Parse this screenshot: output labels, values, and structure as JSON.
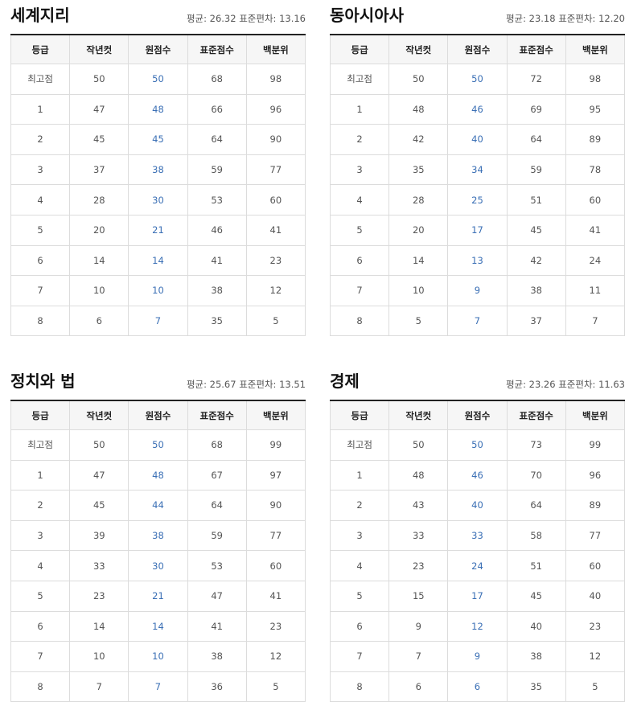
{
  "colors": {
    "raw_score": "#3a6fb5",
    "header_bg": "#f6f6f6",
    "border": "#dcdcdc"
  },
  "headers": [
    "등급",
    "작년컷",
    "원점수",
    "표준점수",
    "백분위"
  ],
  "panels": [
    {
      "title": "세계지리",
      "stats": "평균: 26.32 표준편차: 13.16",
      "rows": [
        [
          "최고점",
          "50",
          "50",
          "68",
          "98"
        ],
        [
          "1",
          "47",
          "48",
          "66",
          "96"
        ],
        [
          "2",
          "45",
          "45",
          "64",
          "90"
        ],
        [
          "3",
          "37",
          "38",
          "59",
          "77"
        ],
        [
          "4",
          "28",
          "30",
          "53",
          "60"
        ],
        [
          "5",
          "20",
          "21",
          "46",
          "41"
        ],
        [
          "6",
          "14",
          "14",
          "41",
          "23"
        ],
        [
          "7",
          "10",
          "10",
          "38",
          "12"
        ],
        [
          "8",
          "6",
          "7",
          "35",
          "5"
        ]
      ]
    },
    {
      "title": "동아시아사",
      "stats": "평균: 23.18 표준편차: 12.20",
      "rows": [
        [
          "최고점",
          "50",
          "50",
          "72",
          "98"
        ],
        [
          "1",
          "48",
          "46",
          "69",
          "95"
        ],
        [
          "2",
          "42",
          "40",
          "64",
          "89"
        ],
        [
          "3",
          "35",
          "34",
          "59",
          "78"
        ],
        [
          "4",
          "28",
          "25",
          "51",
          "60"
        ],
        [
          "5",
          "20",
          "17",
          "45",
          "41"
        ],
        [
          "6",
          "14",
          "13",
          "42",
          "24"
        ],
        [
          "7",
          "10",
          "9",
          "38",
          "11"
        ],
        [
          "8",
          "5",
          "7",
          "37",
          "7"
        ]
      ]
    },
    {
      "title": "정치와 법",
      "stats": "평균: 25.67 표준편차: 13.51",
      "rows": [
        [
          "최고점",
          "50",
          "50",
          "68",
          "99"
        ],
        [
          "1",
          "47",
          "48",
          "67",
          "97"
        ],
        [
          "2",
          "45",
          "44",
          "64",
          "90"
        ],
        [
          "3",
          "39",
          "38",
          "59",
          "77"
        ],
        [
          "4",
          "33",
          "30",
          "53",
          "60"
        ],
        [
          "5",
          "23",
          "21",
          "47",
          "41"
        ],
        [
          "6",
          "14",
          "14",
          "41",
          "23"
        ],
        [
          "7",
          "10",
          "10",
          "38",
          "12"
        ],
        [
          "8",
          "7",
          "7",
          "36",
          "5"
        ]
      ]
    },
    {
      "title": "경제",
      "stats": "평균: 23.26 표준편차: 11.63",
      "rows": [
        [
          "최고점",
          "50",
          "50",
          "73",
          "99"
        ],
        [
          "1",
          "48",
          "46",
          "70",
          "96"
        ],
        [
          "2",
          "43",
          "40",
          "64",
          "89"
        ],
        [
          "3",
          "33",
          "33",
          "58",
          "77"
        ],
        [
          "4",
          "23",
          "24",
          "51",
          "60"
        ],
        [
          "5",
          "15",
          "17",
          "45",
          "40"
        ],
        [
          "6",
          "9",
          "12",
          "40",
          "23"
        ],
        [
          "7",
          "7",
          "9",
          "38",
          "12"
        ],
        [
          "8",
          "6",
          "6",
          "35",
          "5"
        ]
      ]
    }
  ]
}
